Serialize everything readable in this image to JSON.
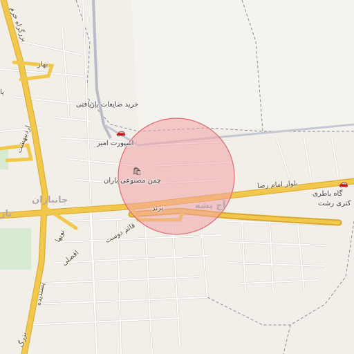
{
  "map": {
    "style": "street-map-light",
    "colors": {
      "background": "#f2efe9",
      "major_road": "#f1c84b",
      "major_road_casing": "#d9a92f",
      "minor_road": "#ffffff",
      "minor_road_casing": "#cfcac2",
      "highlight_circle_fill": "#f3a3a8",
      "highlight_circle_stroke": "#e06b73",
      "boundary": "#8a8a9a"
    },
    "highlight_circle": {
      "shape": "circle"
    }
  },
  "labels": {
    "poi_scrap": "خرید ضایعات بازیافتی",
    "poi_esport": "اسپورت امیر",
    "poi_grass": "چمن مصنوعی باران",
    "poi_battery": "گاه باطری",
    "poi_battery_2": "کتری رشت",
    "road_imam_reza": "بلوار امام رضا",
    "road_parand": "پرند",
    "road_qaem": "قائم دوست",
    "road_naviya": "نوبها",
    "road_afzali": "افضلی",
    "road_bahar": "بهار",
    "road_ordibehesht": "اردیبهشت",
    "road_bozorgrah": "بزرگراه خرم",
    "road_bozorgrah_2": "بزرگ",
    "road_pasandide": "پسندیده",
    "road_ta": "تا",
    "road_b": "پا",
    "district_jannaz": "جانبازان",
    "district_ajsheshe": "آج بشه",
    "district_ta2": "تاز"
  },
  "icons": {
    "car": "car-icon",
    "shop": "shop-icon"
  }
}
